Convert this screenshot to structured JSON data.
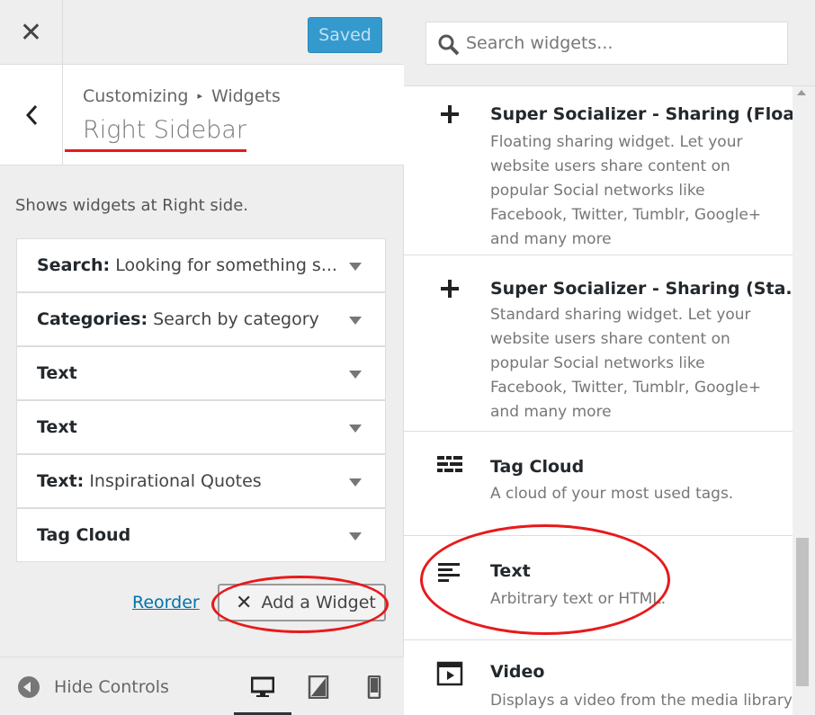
{
  "topbar": {
    "close_icon": "close-icon",
    "saved_label": "Saved",
    "saved_color": "#3499cd"
  },
  "header": {
    "breadcrumb_root": "Customizing",
    "breadcrumb_sep": "▸",
    "breadcrumb_section": "Widgets",
    "title": "Right Sidebar"
  },
  "panel": {
    "description": "Shows widgets at Right side."
  },
  "widgets": [
    {
      "title": "Search:",
      "subtitle": "Looking for something s..."
    },
    {
      "title": "Categories:",
      "subtitle": "Search by category"
    },
    {
      "title": "Text",
      "subtitle": ""
    },
    {
      "title": "Text",
      "subtitle": ""
    },
    {
      "title": "Text:",
      "subtitle": "Inspirational Quotes"
    },
    {
      "title": "Tag Cloud",
      "subtitle": ""
    }
  ],
  "actions": {
    "reorder_label": "Reorder",
    "add_widget_label": "Add a Widget"
  },
  "footer": {
    "hide_controls_label": "Hide Controls"
  },
  "available": {
    "search_placeholder": "Search widgets...",
    "items": [
      {
        "name": "Super Socializer - Sharing (Floa...",
        "description": "Floating sharing widget. Let your website users share content on popular Social networks like Facebook, Twitter, Tumblr, Google+ and many more",
        "icon": "plus-icon"
      },
      {
        "name": "Super Socializer - Sharing (Sta...",
        "description": "Standard sharing widget. Let your website users share content on popular Social networks like Facebook, Twitter, Tumblr, Google+ and many more",
        "icon": "plus-icon"
      },
      {
        "name": "Tag Cloud",
        "description": "A cloud of your most used tags.",
        "icon": "tag-cloud-icon"
      },
      {
        "name": "Text",
        "description": "Arbitrary text or HTML.",
        "icon": "text-icon"
      },
      {
        "name": "Video",
        "description": "Displays a video from the media library",
        "icon": "video-icon"
      }
    ]
  },
  "annotation_color": "#e8191b"
}
